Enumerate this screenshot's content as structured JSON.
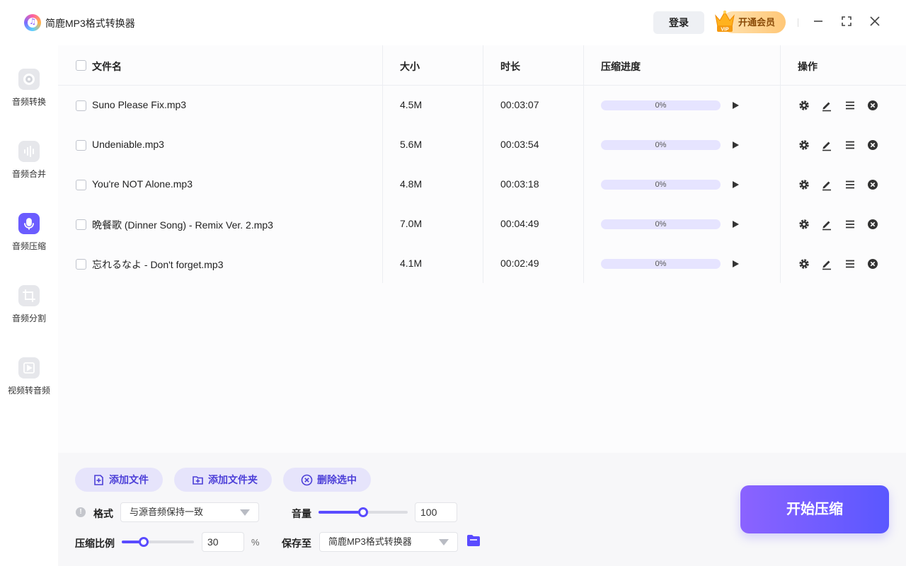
{
  "app": {
    "title": "简鹿MP3格式转换器",
    "login_label": "登录",
    "vip_label": "开通会员",
    "vip_badge": "VIP"
  },
  "sidebar": {
    "items": [
      {
        "label": "音频转换",
        "icon": "disc-icon"
      },
      {
        "label": "音频合并",
        "icon": "waveform-icon"
      },
      {
        "label": "音频压缩",
        "icon": "microphone-compress-icon",
        "active": true
      },
      {
        "label": "音频分割",
        "icon": "crop-icon"
      },
      {
        "label": "视频转音频",
        "icon": "video-play-icon"
      }
    ]
  },
  "table": {
    "headers": {
      "name": "文件名",
      "size": "大小",
      "duration": "时长",
      "progress": "压缩进度",
      "actions": "操作"
    },
    "rows": [
      {
        "name": "Suno Please Fix.mp3",
        "size": "4.5M",
        "duration": "00:03:07",
        "progress": 0,
        "progress_text": "0%"
      },
      {
        "name": "Undeniable.mp3",
        "size": "5.6M",
        "duration": "00:03:54",
        "progress": 0,
        "progress_text": "0%"
      },
      {
        "name": "You're NOT Alone.mp3",
        "size": "4.8M",
        "duration": "00:03:18",
        "progress": 0,
        "progress_text": "0%"
      },
      {
        "name": "晩餐歌 (Dinner Song) - Remix Ver. 2.mp3",
        "size": "7.0M",
        "duration": "00:04:49",
        "progress": 0,
        "progress_text": "0%"
      },
      {
        "name": "忘れるなよ - Don't forget.mp3",
        "size": "4.1M",
        "duration": "00:02:49",
        "progress": 0,
        "progress_text": "0%"
      }
    ]
  },
  "bottom": {
    "add_file_label": "添加文件",
    "add_folder_label": "添加文件夹",
    "delete_selected_label": "删除选中",
    "format_label": "格式",
    "format_value": "与源音频保持一致",
    "volume_label": "音量",
    "volume_value": "100",
    "volume_level": 0.5,
    "ratio_label": "压缩比例",
    "ratio_value": "30",
    "ratio_level": 0.3,
    "ratio_unit": "%",
    "save_to_label": "保存至",
    "save_to_value": "简鹿MP3格式转换器",
    "start_label": "开始压缩"
  },
  "colors": {
    "accent": "#5a4bff",
    "accent_light": "#e6e4fb",
    "vip_gold": "#ffc777"
  }
}
